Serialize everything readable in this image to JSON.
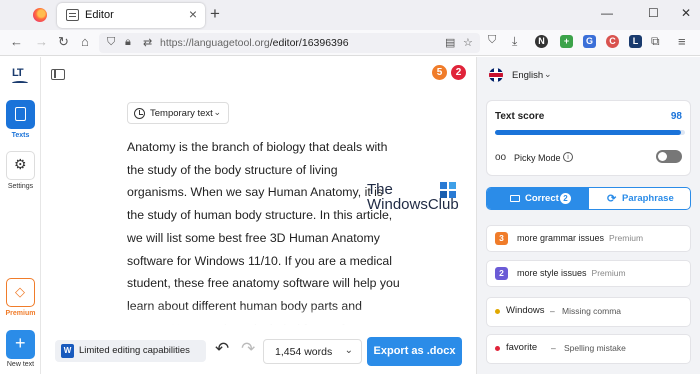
{
  "browser": {
    "tab_title": "Editor",
    "url_domain": "https://languagetool.org",
    "url_path": "/editor/16396396",
    "win_min": "—",
    "win_max": "☐",
    "win_close": "✕"
  },
  "sidebar": {
    "logo": "LT",
    "texts_label": "Texts",
    "settings_label": "Settings",
    "premium_label": "Premium",
    "new_text_label": "New text"
  },
  "badges": {
    "orange": "5",
    "red": "2"
  },
  "editor": {
    "mode_label": "Temporary text",
    "paragraph": "Anatomy is the branch of biology that deals with the study of the body structure of living organisms. When we say Human Anatomy, it is the study of human body structure. In this article, we will list some best free 3D Human Anatomy software for Windows 11/10. If you are a medical student, these free anatomy software will help you learn about different human body parts and organs. Here, we have included free software, Microsoft Store apps, and web apps. To use"
  },
  "watermark": {
    "line1": "The",
    "line2": "WindowsClub"
  },
  "toolbar": {
    "limited_label": "Limited editing capabilities",
    "word_count": "1,454 words",
    "export_label": "Export as .docx"
  },
  "panel": {
    "language": "English",
    "text_score_label": "Text score",
    "text_score_value": "98",
    "text_score_fraction": 0.98,
    "picky_mode_label": "Picky Mode",
    "tab_correct": "Correct",
    "tab_correct_count": "2",
    "tab_paraphrase": "Paraphrase",
    "issues": [
      {
        "count": "3",
        "text": "more grammar issues",
        "tag": "Premium",
        "color": "#f07c2a"
      },
      {
        "count": "2",
        "text": "more style issues",
        "tag": "Premium",
        "color": "#6b5bd6"
      }
    ],
    "mistakes": [
      {
        "word": "Windows",
        "sep": "–",
        "desc": "Missing comma",
        "color": "#e0a800"
      },
      {
        "word": "favorite",
        "sep": "–",
        "desc": "Spelling mistake",
        "color": "#e0243a"
      }
    ]
  }
}
